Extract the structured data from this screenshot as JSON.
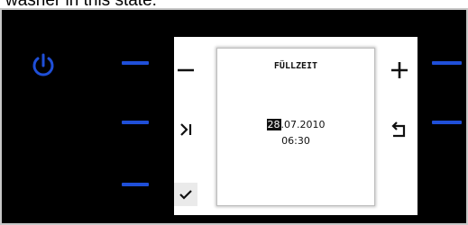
{
  "caption": "washer in this state:",
  "screen": {
    "title": "FÜLLZEIT",
    "date_day": "28",
    "date_rest": ".07.2010",
    "time": "06:30"
  },
  "icons": {
    "power": "power-icon",
    "minus": "minus-icon",
    "skip": "skip-next-icon",
    "confirm": "checkmark-icon",
    "plus": "plus-icon",
    "back": "back-return-icon"
  },
  "colors": {
    "accent": "#1f4fd8",
    "panel": "#000000",
    "display": "#ffffff"
  }
}
